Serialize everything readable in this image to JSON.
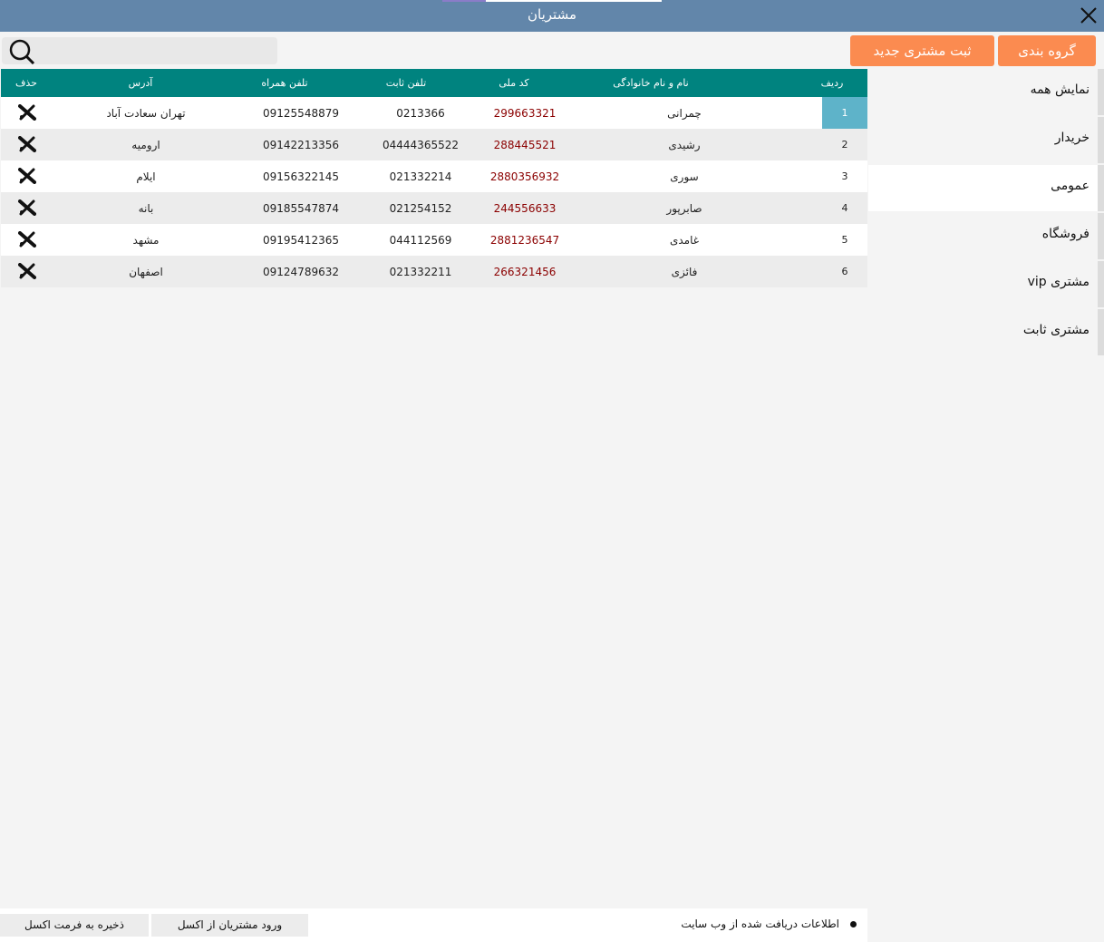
{
  "window": {
    "title": "مشتریان"
  },
  "toolbar": {
    "search_placeholder": "",
    "group_label": "گروه بندی",
    "new_customer_label": "ثبت مشتری جدید"
  },
  "table": {
    "headers": {
      "row": "ردیف",
      "name": "نام و نام خانوادگی",
      "national_code": "کد ملی",
      "landline": "تلفن ثابت",
      "mobile": "تلفن همراه",
      "address": "آدرس",
      "delete": "حذف"
    },
    "rows": [
      {
        "row": "1",
        "name": "چمرانی",
        "national_code": "299663321",
        "landline": "0213366",
        "mobile": "09125548879",
        "address": "تهران سعادت آباد"
      },
      {
        "row": "2",
        "name": "رشیدی",
        "national_code": "288445521",
        "landline": "04444365522",
        "mobile": "09142213356",
        "address": "ارومیه"
      },
      {
        "row": "3",
        "name": "سوری",
        "national_code": "2880356932",
        "landline": "021332214",
        "mobile": "09156322145",
        "address": "ایلام"
      },
      {
        "row": "4",
        "name": "صابرپور",
        "national_code": "244556633",
        "landline": "021254152",
        "mobile": "09185547874",
        "address": "بانه"
      },
      {
        "row": "5",
        "name": "غامدی",
        "national_code": "2881236547",
        "landline": "044112569",
        "mobile": "09195412365",
        "address": "مشهد"
      },
      {
        "row": "6",
        "name": "فائزی",
        "national_code": "266321456",
        "landline": "021332211",
        "mobile": "09124789632",
        "address": "اصفهان"
      }
    ],
    "selected_row": "1"
  },
  "sidebar": {
    "items": [
      {
        "label": "نمایش همه"
      },
      {
        "label": "خریدار"
      },
      {
        "label": "عمومی"
      },
      {
        "label": "فروشگاه"
      },
      {
        "label": "مشتری vip"
      },
      {
        "label": "مشتری ثابت"
      }
    ],
    "active_index": 2
  },
  "footer": {
    "save_excel_label": "ذخیره به فرمت اکسل",
    "import_excel_label": "ورود مشتریان از اکسل",
    "web_info_label": "اطلاعات دریافت شده از وب سایت"
  },
  "colors": {
    "titlebar": "#6286aa",
    "header": "#00837f",
    "accent_orange": "#fb8b50",
    "selected_row": "#5eb3c9",
    "national_code_text": "#8b0000"
  },
  "icons": {
    "close": "close-icon",
    "search": "search-icon",
    "delete": "delete-x-icon"
  }
}
